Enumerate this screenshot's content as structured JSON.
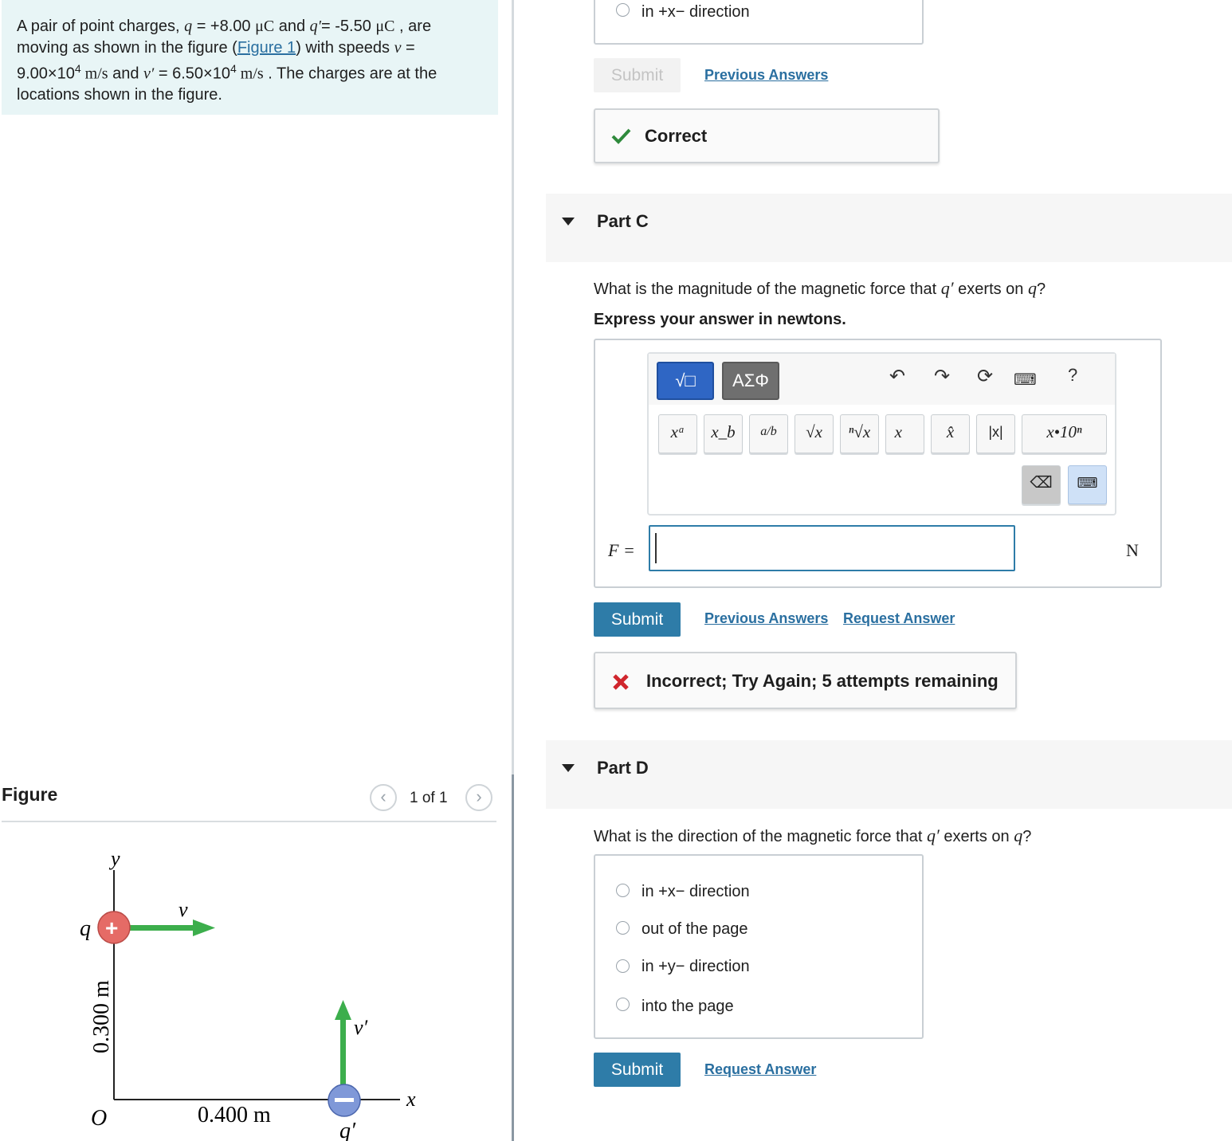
{
  "problem": {
    "text_1": "A pair of point charges, ",
    "q_sym": "q",
    "eq_1": " = +8.00 ",
    "unit_uC": "μC",
    "text_and": " and ",
    "qp_sym": "q′",
    "eq_2": "= -5.50 ",
    "text_2": " , are moving as shown in the figure (",
    "figure_link": "Figure 1",
    "text_3": ") with speeds ",
    "v_sym": "v",
    "eq_3": " = ",
    "v_val": "9.00×10",
    "exp": "4",
    "unit_ms": " m/s",
    "vp_sym": "v′",
    "eq_4": " = ",
    "vp_val": "6.50×10",
    "text_4": " . The charges are at the locations shown in the figure."
  },
  "figure": {
    "title": "Figure",
    "counter": "1 of 1",
    "prev_icon": "chevron-left-icon",
    "next_icon": "chevron-right-icon",
    "labels": {
      "y_axis": "y",
      "x_axis": "x",
      "origin": "O",
      "q": "q",
      "v": "v",
      "q_prime": "q′",
      "v_prime": "v′",
      "dist_y": "0.300 m",
      "dist_x": "0.400 m",
      "plus": "+",
      "minus": "−"
    },
    "colors": {
      "arrow": "#3cae4c",
      "positive": "#d9534f",
      "negative": "#5b7fd1"
    }
  },
  "top_section": {
    "option_label": "in +x− direction",
    "submit_label": "Submit",
    "previous_answers": "Previous Answers",
    "feedback_label": "Correct",
    "feedback_icon": "checkmark-icon"
  },
  "part_c": {
    "title": "Part C",
    "question_pre": "What is the magnitude of the magnetic force that ",
    "question_qp": "q′",
    "question_mid": " exerts on ",
    "question_q": "q",
    "question_end": "?",
    "instruction": "Express your answer in newtons.",
    "toolbar": {
      "tab_templates": "√□",
      "tab_symbols": "ΑΣΦ",
      "undo_icon": "undo-icon",
      "redo_icon": "redo-icon",
      "reset_icon": "reset-icon",
      "keyboard_icon": "keyboard-icon",
      "help": "?",
      "keys": [
        "xᵃ",
        "x_b",
        "a/b",
        "√x",
        "ⁿ√x",
        "x⃗",
        "x̂",
        "|x|",
        "x•10ⁿ"
      ],
      "backspace_icon": "backspace-icon",
      "keyboard_toggle_icon": "keyboard-toggle-icon"
    },
    "answer_label": "F =",
    "answer_value": "",
    "unit": "N",
    "submit_label": "Submit",
    "previous_answers": "Previous Answers",
    "request_answer": "Request Answer",
    "feedback_label": "Incorrect; Try Again; 5 attempts remaining",
    "feedback_icon": "x-mark-icon"
  },
  "part_d": {
    "title": "Part D",
    "question_pre": "What is the direction of the magnetic force that ",
    "question_qp": "q′",
    "question_mid": " exerts on ",
    "question_q": "q",
    "question_end": "?",
    "options": [
      "in +x− direction",
      "out of the page",
      "in +y− direction",
      "into the page"
    ],
    "submit_label": "Submit",
    "request_answer": "Request Answer"
  },
  "colors": {
    "accent": "#2e7ca8",
    "link": "#2a6fa0",
    "problem_bg": "#e8f5f6",
    "correct": "#2f8a3c",
    "incorrect": "#d0262d"
  }
}
